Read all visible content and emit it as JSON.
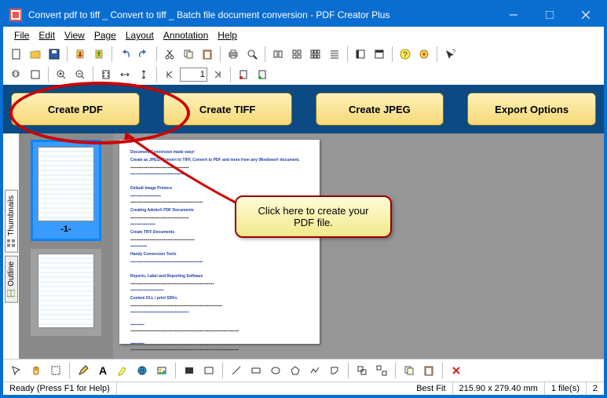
{
  "window": {
    "title": "Convert pdf to tiff _ Convert to tiff _ Batch file document conversion - PDF Creator Plus"
  },
  "menu": {
    "file": "File",
    "edit": "Edit",
    "view": "View",
    "page": "Page",
    "layout": "Layout",
    "annotation": "Annotation",
    "help": "Help"
  },
  "page_control": {
    "current": "1"
  },
  "main_buttons": {
    "create_pdf": "Create PDF",
    "create_tiff": "Create TIFF",
    "create_jpeg": "Create JPEG",
    "export_options": "Export Options"
  },
  "side_tabs": {
    "thumbnails": "Thumbnails",
    "outline": "Outline"
  },
  "thumbnails": [
    {
      "label": "-1-",
      "selected": true
    },
    {
      "label": "",
      "selected": false
    }
  ],
  "callout": {
    "text": "Click here to create your PDF file."
  },
  "document": {
    "title": "Document Conversion made easy!",
    "h1": "Create as JPEG, Convert to TIFF, Convert to PDF and more from any Windows® document.",
    "h2": "Default Image Printers",
    "h3": "Creating Adobe® PDF Documents",
    "h4": "Create TIFF Documents",
    "h5": "Handy Conversion Tools",
    "h6": "Reports, Label and Reporting Software",
    "h7": "Custom DLL / print SDKs"
  },
  "status": {
    "ready": "Ready (Press F1 for Help)",
    "zoom": "Best Fit",
    "dims": "215.90 x 279.40 mm",
    "files": "1 file(s)",
    "page": "2"
  }
}
